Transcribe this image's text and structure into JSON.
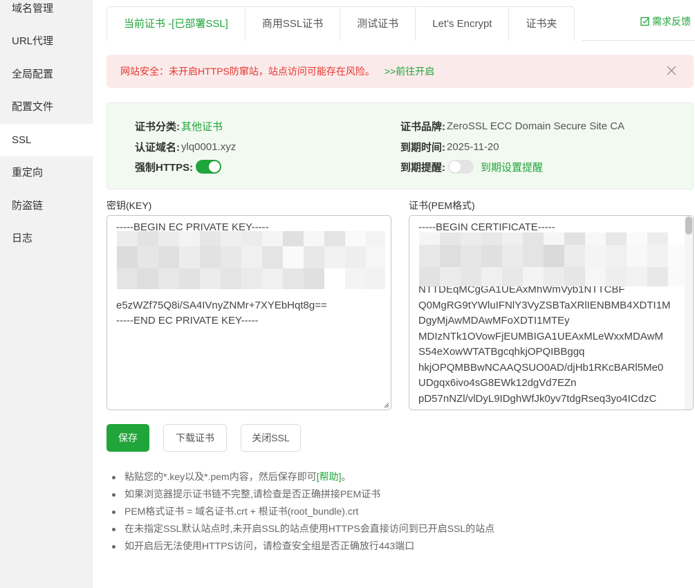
{
  "sidebar": {
    "items": [
      {
        "label": "域名管理"
      },
      {
        "label": "URL代理"
      },
      {
        "label": "全局配置"
      },
      {
        "label": "配置文件"
      },
      {
        "label": "SSL"
      },
      {
        "label": "重定向"
      },
      {
        "label": "防盗链"
      },
      {
        "label": "日志"
      }
    ],
    "active": "SSL"
  },
  "tabs": [
    {
      "label": "当前证书 -[已部署SSL]"
    },
    {
      "label": "商用SSL证书"
    },
    {
      "label": "测试证书"
    },
    {
      "label": "Let's Encrypt"
    },
    {
      "label": "证书夹"
    }
  ],
  "feedback": {
    "label": "需求反馈"
  },
  "alert": {
    "text": "网站安全：未开启HTTPS防窜站，站点访问可能存在风险。",
    "link": ">>前往开启"
  },
  "cert_info": {
    "category_label": "证书分类:",
    "category_value": "其他证书",
    "brand_label": "证书品牌:",
    "brand_value": "ZeroSSL ECC Domain Secure Site CA",
    "domain_label": "认证域名:",
    "domain_value": "ylq0001.xyz",
    "expire_label": "到期时间:",
    "expire_value": "2025-11-20",
    "force_https_label": "强制HTTPS:",
    "force_https_on": true,
    "reminder_label": "到期提醒:",
    "reminder_on": false,
    "reminder_link": "到期设置提醒"
  },
  "key_editor": {
    "label": "密钥(KEY)",
    "content": "-----BEGIN EC PRIVATE KEY-----\n\n\n\n\ne5zWZf75Q8i/SA4IVnyZNMr+7XYEbHqt8g==\n-----END EC PRIVATE KEY-----"
  },
  "cert_editor": {
    "label": "证书(PEM格式)",
    "content": "-----BEGIN CERTIFICATE-----\n\n\n\nNTTDEqMCgGA1UEAxMhWmVyb1NTTCBF\nQ0MgRG9tYWluIFNlY3VyZSBTaXRlIENBMB4XDTI1M\nDgyMjAwMDAwMFoXDTI1MTEy\nMDIzNTk1OVowFjEUMBIGA1UEAxMLeWxxMDAwM\nS54eXowWTATBgcqhkjOPQIBBggq\nhkjOPQMBBwNCAAQSUO0AD/djHb1RKcBARl5Me0\nUDgqx6ivo4sG8EWk12dgVd7EZn\npD57nNZl/vlDyL9IDghWfJk0yv7tdgRseq3yo4ICdzC"
  },
  "buttons": {
    "save": "保存",
    "download": "下载证书",
    "close_ssl": "关闭SSL"
  },
  "tips": {
    "tip1_prefix": "粘贴您的*.key以及*.pem内容，然后保存即可",
    "tip1_link": "[帮助]",
    "tip1_suffix": "。",
    "tip2": "如果浏览器提示证书链不完整,请检查是否正确拼接PEM证书",
    "tip3": "PEM格式证书 = 域名证书.crt + 根证书(root_bundle).crt",
    "tip4": "在未指定SSL默认站点时,未开启SSL的站点使用HTTPS会直接访问到已开启SSL的站点",
    "tip5": "如开启后无法使用HTTPS访问，请检查安全组是否正确放行443端口"
  },
  "colors": {
    "accent": "#20a53a",
    "danger": "#e5362f",
    "alert_bg": "#fbeaea",
    "info_bg": "#f2f9f1"
  }
}
